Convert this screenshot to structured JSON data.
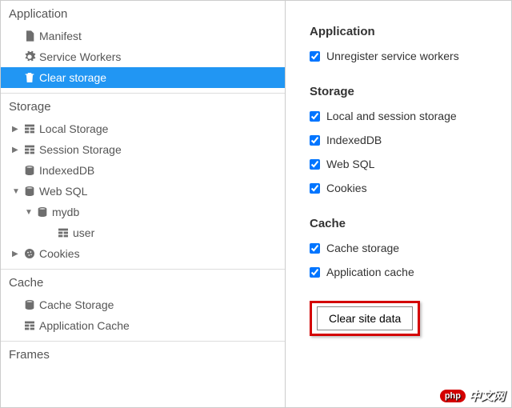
{
  "sidebar": {
    "sections": {
      "application": {
        "title": "Application",
        "items": [
          {
            "label": "Manifest"
          },
          {
            "label": "Service Workers"
          },
          {
            "label": "Clear storage"
          }
        ]
      },
      "storage": {
        "title": "Storage",
        "items": [
          {
            "label": "Local Storage"
          },
          {
            "label": "Session Storage"
          },
          {
            "label": "IndexedDB"
          },
          {
            "label": "Web SQL"
          },
          {
            "label": "mydb"
          },
          {
            "label": "user"
          },
          {
            "label": "Cookies"
          }
        ]
      },
      "cache": {
        "title": "Cache",
        "items": [
          {
            "label": "Cache Storage"
          },
          {
            "label": "Application Cache"
          }
        ]
      },
      "frames": {
        "title": "Frames"
      }
    }
  },
  "main": {
    "application": {
      "title": "Application",
      "checks": [
        {
          "label": "Unregister service workers"
        }
      ]
    },
    "storage": {
      "title": "Storage",
      "checks": [
        {
          "label": "Local and session storage"
        },
        {
          "label": "IndexedDB"
        },
        {
          "label": "Web SQL"
        },
        {
          "label": "Cookies"
        }
      ]
    },
    "cache": {
      "title": "Cache",
      "checks": [
        {
          "label": "Cache storage"
        },
        {
          "label": "Application cache"
        }
      ]
    },
    "clear_button": "Clear site data"
  },
  "watermark": {
    "badge": "php",
    "text": "中文网"
  }
}
